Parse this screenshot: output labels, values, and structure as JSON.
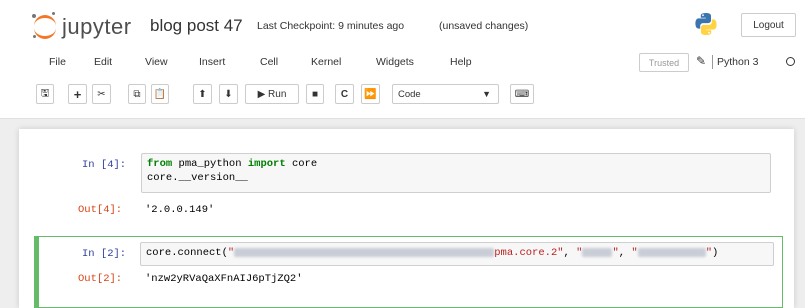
{
  "header": {
    "logo_text": "jupyter",
    "notebook_name": "blog post 47",
    "checkpoint": "Last Checkpoint: 9 minutes ago",
    "unsaved": "(unsaved changes)",
    "logout_label": "Logout",
    "python_logo_icon": "python-logo-icon"
  },
  "menu": {
    "items": [
      "File",
      "Edit",
      "View",
      "Insert",
      "Cell",
      "Kernel",
      "Widgets",
      "Help"
    ],
    "trusted_label": "Trusted",
    "kernel_name": "Python 3"
  },
  "toolbar": {
    "buttons": [
      {
        "name": "save-icon",
        "glyph": "🖫"
      },
      {
        "name": "insert-cell-icon",
        "glyph": "+"
      },
      {
        "name": "cut-icon",
        "glyph": "✂"
      },
      {
        "name": "copy-icon",
        "glyph": "⧉"
      },
      {
        "name": "paste-icon",
        "glyph": "📋"
      },
      {
        "name": "move-up-icon",
        "glyph": "⬆"
      },
      {
        "name": "move-down-icon",
        "glyph": "⬇"
      },
      {
        "name": "run-button",
        "glyph": "▶ Run"
      },
      {
        "name": "interrupt-icon",
        "glyph": "■"
      },
      {
        "name": "restart-icon",
        "glyph": "C"
      },
      {
        "name": "restart-run-all-icon",
        "glyph": "⏩"
      }
    ],
    "cell_type": "Code",
    "command_palette_icon": "keyboard-icon"
  },
  "cells": [
    {
      "in_prompt": "In [4]:",
      "code_line1_kw1": "from",
      "code_line1_mid": " pma_python ",
      "code_line1_kw2": "import",
      "code_line1_end": " core",
      "code_line2": "core.__version__",
      "out_prompt": "Out[4]:",
      "output": "'2.0.0.149'"
    },
    {
      "in_prompt": "In [2]:",
      "code_prefix": "core.connect(",
      "code_str1_open": "\"",
      "code_str1_close": "pma.core.2\"",
      "code_sep1": ", ",
      "code_str2_open": "\"",
      "code_str2_close": "\"",
      "code_sep2": ", ",
      "code_str3_open": "\"",
      "code_str3_close": "\"",
      "code_suffix": ")",
      "out_prompt": "Out[2]:",
      "output": "'nzw2yRVaQaXFnAIJ6pTjZQ2'"
    }
  ]
}
